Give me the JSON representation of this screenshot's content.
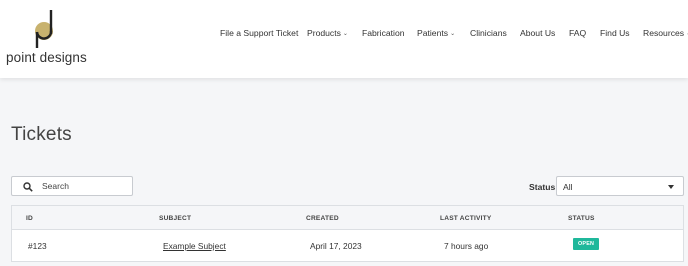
{
  "brand": {
    "name": "point designs",
    "accent": "#c8b26e"
  },
  "nav": {
    "items": [
      {
        "label": "File a Support Ticket",
        "dropdown": false
      },
      {
        "label": "Products",
        "dropdown": true
      },
      {
        "label": "Fabrication",
        "dropdown": false
      },
      {
        "label": "Patients",
        "dropdown": true
      },
      {
        "label": "Clinicians",
        "dropdown": false
      },
      {
        "label": "About Us",
        "dropdown": false
      },
      {
        "label": "FAQ",
        "dropdown": false
      },
      {
        "label": "Find Us",
        "dropdown": false
      },
      {
        "label": "Resources",
        "dropdown": true
      }
    ]
  },
  "page": {
    "title": "Tickets"
  },
  "search": {
    "placeholder": "Search",
    "icon": "search-icon"
  },
  "filter": {
    "label": "Status",
    "value": "All"
  },
  "table": {
    "headers": [
      "ID",
      "SUBJECT",
      "CREATED",
      "LAST ACTIVITY",
      "STATUS"
    ],
    "rows": [
      {
        "id": "#123",
        "subject": "Example Subject",
        "created": "April 17, 2023",
        "last_activity": "7 hours ago",
        "status": "OPEN"
      }
    ]
  },
  "colors": {
    "status_open": "#1fb89b"
  }
}
